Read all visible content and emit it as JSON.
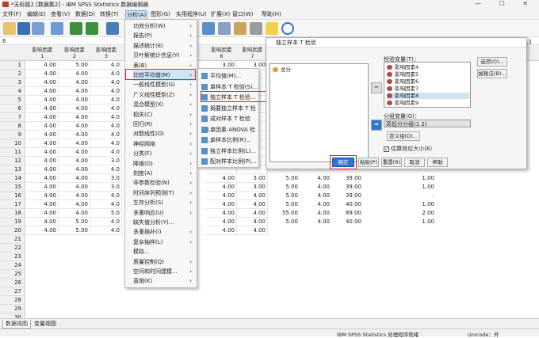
{
  "window": {
    "title": "*无标题2 [数据集2] - IBM SPSS Statistics 数据编辑器",
    "controls": "— ☐ ✕"
  },
  "menubar": [
    "文件(F)",
    "编辑(E)",
    "查看(V)",
    "数据(D)",
    "转换(T)",
    "分析(A)",
    "图形(G)",
    "实用程序(U)",
    "扩展(X)",
    "窗口(W)",
    "帮助(H)"
  ],
  "cellbar": {
    "row": "6",
    "visible": "可视：11/11 个变量",
    "right_label": "变"
  },
  "grid": {
    "columns": [
      "影响因素\n1",
      "影响因素\n2",
      "影响因素\n3",
      "影响因素\n6",
      "影响因素\n7"
    ],
    "rows": [
      [
        "4.00",
        "5.00",
        "4.0",
        "3.00",
        "3.00"
      ],
      [
        "4.00",
        "4.00",
        "4.0",
        "",
        ""
      ],
      [
        "4.00",
        "4.00",
        "4.0",
        "",
        ""
      ],
      [
        "4.00",
        "4.00",
        "4.0",
        "",
        ""
      ],
      [
        "4.00",
        "4.00",
        "4.0",
        "",
        ""
      ],
      [
        "4.00",
        "4.00",
        "4.0",
        "",
        ""
      ],
      [
        "4.00",
        "4.00",
        "4.0",
        "",
        ""
      ],
      [
        "4.00",
        "4.00",
        "4.0",
        "",
        ""
      ],
      [
        "4.00",
        "4.00",
        "4.0",
        "",
        ""
      ],
      [
        "4.00",
        "4.00",
        "4.0",
        "",
        ""
      ],
      [
        "4.00",
        "4.00",
        "4.0",
        "",
        ""
      ],
      [
        "4.00",
        "4.00",
        "3.0",
        "",
        ""
      ],
      [
        "4.00",
        "4.00",
        "4.0",
        "",
        ""
      ],
      [
        "4.00",
        "4.00",
        "3.0",
        "4.00",
        "3.00"
      ],
      [
        "4.00",
        "4.00",
        "3.0",
        "4.00",
        "3.00"
      ],
      [
        "4.00",
        "4.00",
        "4.0",
        "4.00",
        "4.00"
      ],
      [
        "4.00",
        "4.00",
        "4.0",
        "4.00",
        "4.00"
      ],
      [
        "4.00",
        "4.00",
        "5.0",
        "4.00",
        "4.00"
      ],
      [
        "4.00",
        "5.00",
        "4.0",
        "4.00",
        "4.00"
      ],
      [
        "4.00",
        "5.00",
        "4.0",
        "4.00",
        "4.00"
      ]
    ],
    "extra_rows": [
      [
        "5.00",
        "4.00",
        "39.00",
        "1.00"
      ],
      [
        "5.00",
        "4.00",
        "39.00",
        "1.00"
      ],
      [
        "5.00",
        "4.00",
        "39.00",
        "."
      ],
      [
        "5.00",
        "4.00",
        "40.00",
        "1.00"
      ],
      [
        "55.00",
        "4.00",
        "89.00",
        "2.00"
      ],
      [
        "5.00",
        "4.00",
        "40.00",
        "1.00"
      ]
    ]
  },
  "analyze_menu": [
    "功效分析(W)",
    "报告(P)",
    "描述统计(E)",
    "贝叶斯统计信息(Y)",
    "表(B)",
    "比较平均值(M)",
    "一般线性模型(G)",
    "广义线性模型(Z)",
    "混合模型(X)",
    "相关(C)",
    "回归(R)",
    "对数线性(O)",
    "神经网络",
    "分类(F)",
    "降维(D)",
    "刻度(A)",
    "非参数检验(N)",
    "时间序列预测(T)",
    "生存分析(S)",
    "多重响应(U)",
    "缺失值分析(Y)...",
    "多重插补(I)",
    "复杂抽样(L)",
    "模拟...",
    "质量控制(Q)",
    "空间和时间建模...",
    "直销(K)"
  ],
  "compare_menu": [
    "平均值(M)...",
    "单样本 T 检验(S)...",
    "独立样本 T 检验...",
    "摘要独立样本 T 检验",
    "成对样本 T 检验(P)...",
    "单因素 ANOVA 检验...",
    "单样本比例(R)...",
    "独立样本比例(L)...",
    "配对样本比例(P)..."
  ],
  "dialog": {
    "title": "独立样本 T 检验",
    "source_var": "总分",
    "test_label": "检验变量(T)：",
    "test_vars": [
      "影响因素4",
      "影响因素5",
      "影响因素6",
      "影响因素7",
      "影响因素8",
      "影响因素9"
    ],
    "group_label": "分组变量(G)：",
    "group_value": "高低分分组(1 2)",
    "define_btn": "定义组(D)...",
    "effect_label": "估算效应大小(E)",
    "side_btns": [
      "选项(O)...",
      "拔靴法(B)..."
    ],
    "buttons": [
      "确定",
      "粘贴(P)",
      "重置(R)",
      "取消",
      "帮助"
    ]
  },
  "tabs": [
    "数据视图",
    "变量视图"
  ],
  "status": {
    "processor": "IBM SPSS Statistics 处理程序就绪",
    "unicode": "Unicode：开"
  },
  "colors": {
    "accent": "#2f76d2",
    "highlight": "#e0262b",
    "selection": "#cde4f7"
  }
}
